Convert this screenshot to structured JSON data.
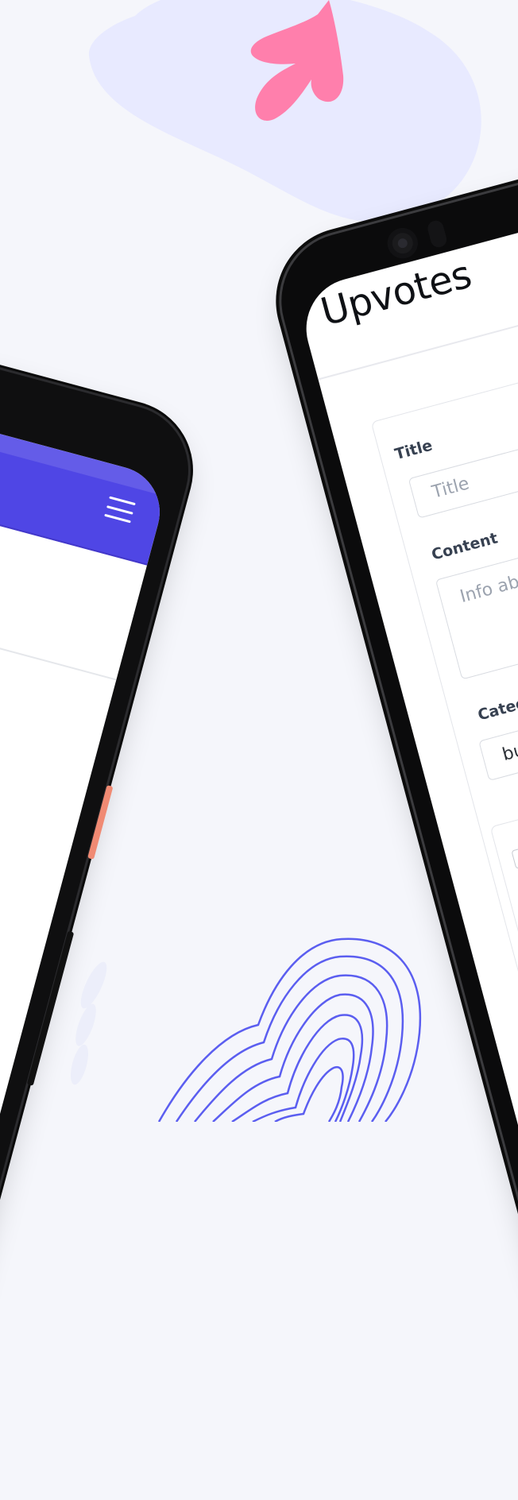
{
  "colors": {
    "background": "#f5f6fb",
    "blob": "#e8eaff",
    "brand_indigo": "#4f46e5",
    "accent_pink": "#ff7fac",
    "contour_lines": "#5b5ef0",
    "orange_button": "#f08a73"
  },
  "left_phone": {
    "appbar_icon": "menu-icon"
  },
  "right_phone": {
    "app_title": "Upvotes",
    "form": {
      "title_label": "Title",
      "title_placeholder": "Title",
      "content_label": "Content",
      "content_placeholder": "Info abo",
      "category_label": "Categor",
      "category_value": "bug"
    }
  }
}
